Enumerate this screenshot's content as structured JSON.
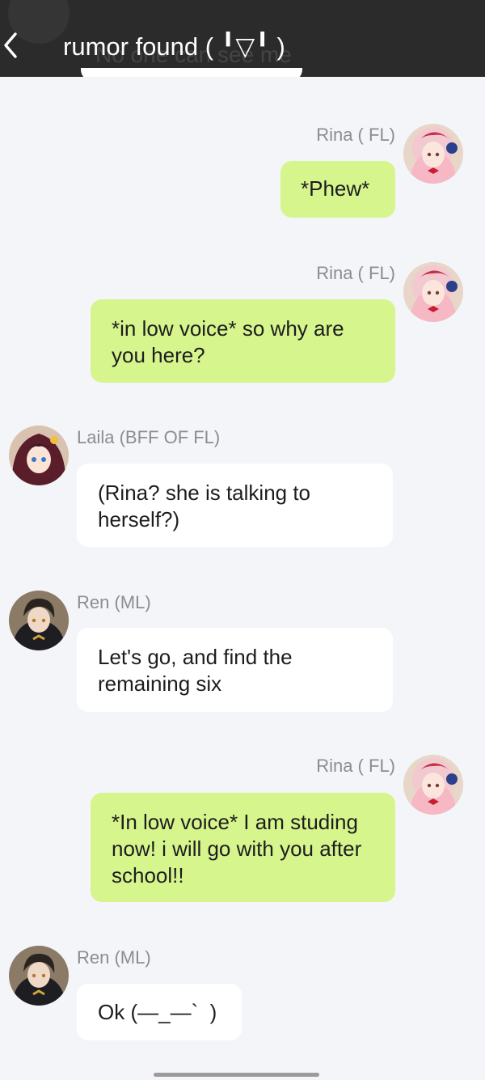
{
  "header": {
    "title": "rumor found ( ╹▽╹ )",
    "ghost_text": "No one can see me"
  },
  "messages": [
    {
      "sender": "Rina ( FL)",
      "text": "*Phew*"
    },
    {
      "sender": "Rina ( FL)",
      "text": "*in low voice* so why are you here?"
    },
    {
      "sender": "Laila (BFF OF FL)",
      "text": "(Rina? she is talking to herself?)"
    },
    {
      "sender": "Ren (ML)",
      "text": "Let's go, and find the remaining six"
    },
    {
      "sender": "Rina ( FL)",
      "text": "*In low voice* I am studing now! i will go with you after school!!"
    },
    {
      "sender": "Ren (ML)",
      "text": "Ok (—_—`  )"
    }
  ],
  "colors": {
    "header_bg": "#2b2b2b",
    "page_bg": "#f3f5f8",
    "my_bubble": "#d6f58c",
    "other_bubble": "#ffffff",
    "name_text": "#8a8d92"
  },
  "icons": {
    "back": "chevron-left-icon"
  }
}
